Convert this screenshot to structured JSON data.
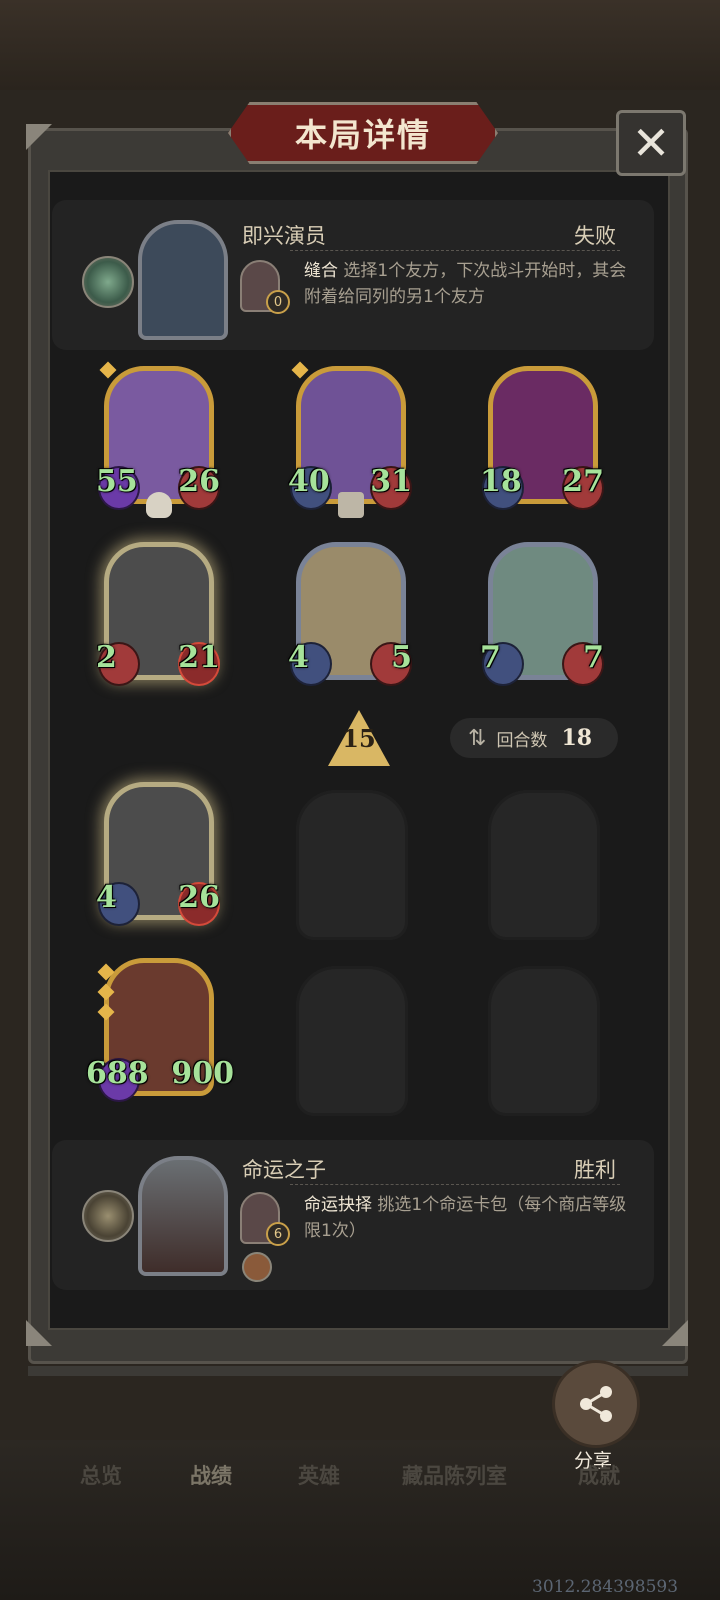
{
  "header": {
    "title": "本局详情",
    "close_glyph": "✕"
  },
  "opponent": {
    "name": "即兴演员",
    "result": "失败",
    "skill_count": "0",
    "skill_name": "缝合",
    "skill_text": " 选择1个友方，下次战斗开始时，其会附着给同列的另1个友方"
  },
  "board": {
    "row1": [
      {
        "atk": "55",
        "hp": "26",
        "frame": "gold",
        "art": "#7a5aa0"
      },
      {
        "atk": "40",
        "hp": "31",
        "frame": "gold",
        "art": "#6f5296"
      },
      {
        "atk": "18",
        "hp": "27",
        "frame": "gold",
        "art": "#6a2b63"
      }
    ],
    "row2": [
      {
        "atk": "2",
        "hp": "21",
        "frame": "glow",
        "art": "#4c4c4c"
      },
      {
        "atk": "4",
        "hp": "5",
        "frame": "silver",
        "art": "#9a8b6a"
      },
      {
        "atk": "7",
        "hp": "7",
        "frame": "silver",
        "art": "#6f8a80"
      }
    ],
    "row3": [
      {
        "atk": "4",
        "hp": "26",
        "frame": "glow",
        "art": "#4c4c4c"
      }
    ],
    "row4": [
      {
        "atk": "688",
        "hp": "900",
        "frame": "gold",
        "art": "#6a3a2e"
      }
    ],
    "level": "15",
    "round_label": "回合数",
    "round_value": "18"
  },
  "player": {
    "name": "命运之子",
    "result": "胜利",
    "skill_count": "6",
    "skill_name": "命运抉择",
    "skill_text": " 挑选1个命运卡包（每个商店等级限1次）"
  },
  "share": {
    "label": "分享"
  },
  "nav": [
    "总览",
    "战绩",
    "英雄",
    "藏品陈列室",
    "成就"
  ],
  "coords": "3012.284398593"
}
